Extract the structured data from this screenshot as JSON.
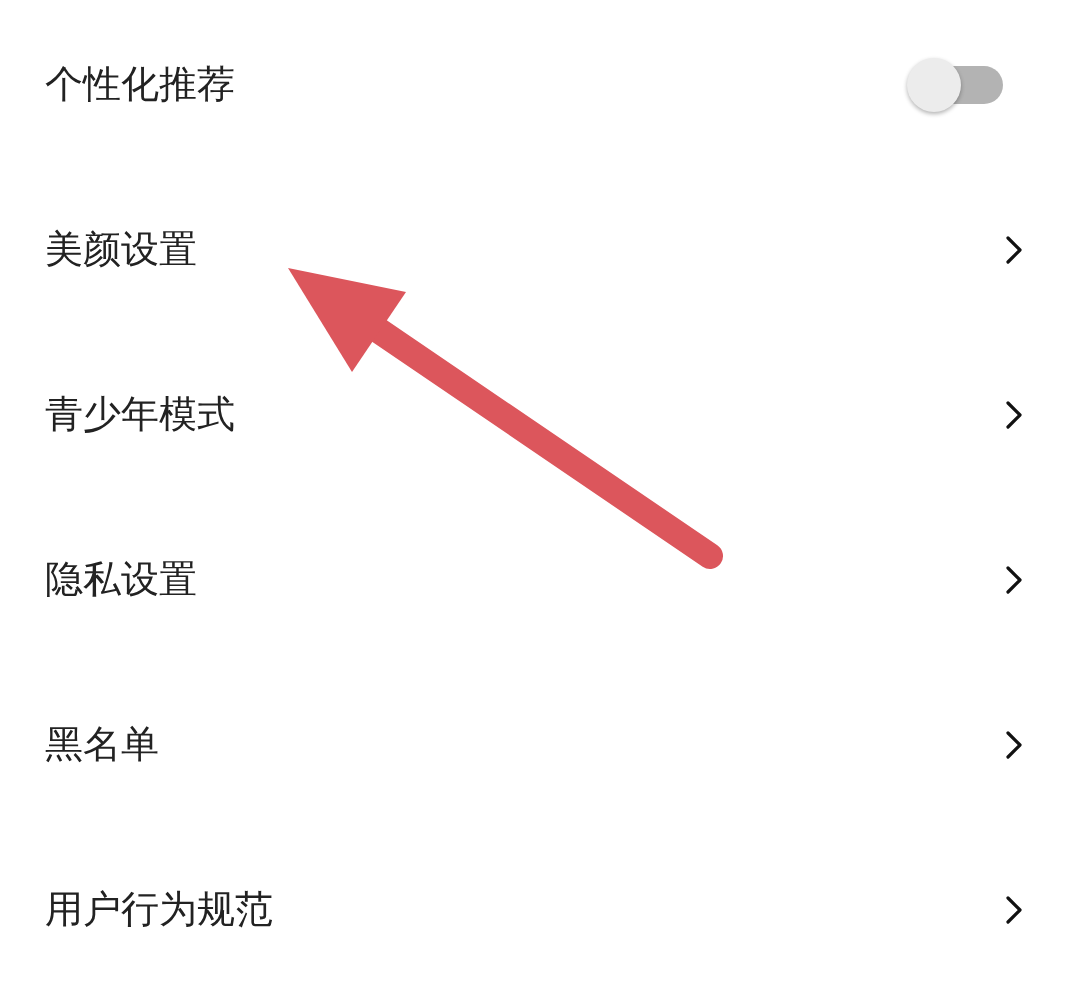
{
  "settings": [
    {
      "label": "个性化推荐",
      "kind": "toggle",
      "on": false
    },
    {
      "label": "美颜设置",
      "kind": "link"
    },
    {
      "label": "青少年模式",
      "kind": "link"
    },
    {
      "label": "隐私设置",
      "kind": "link"
    },
    {
      "label": "黑名单",
      "kind": "link"
    },
    {
      "label": "用户行为规范",
      "kind": "link"
    }
  ]
}
